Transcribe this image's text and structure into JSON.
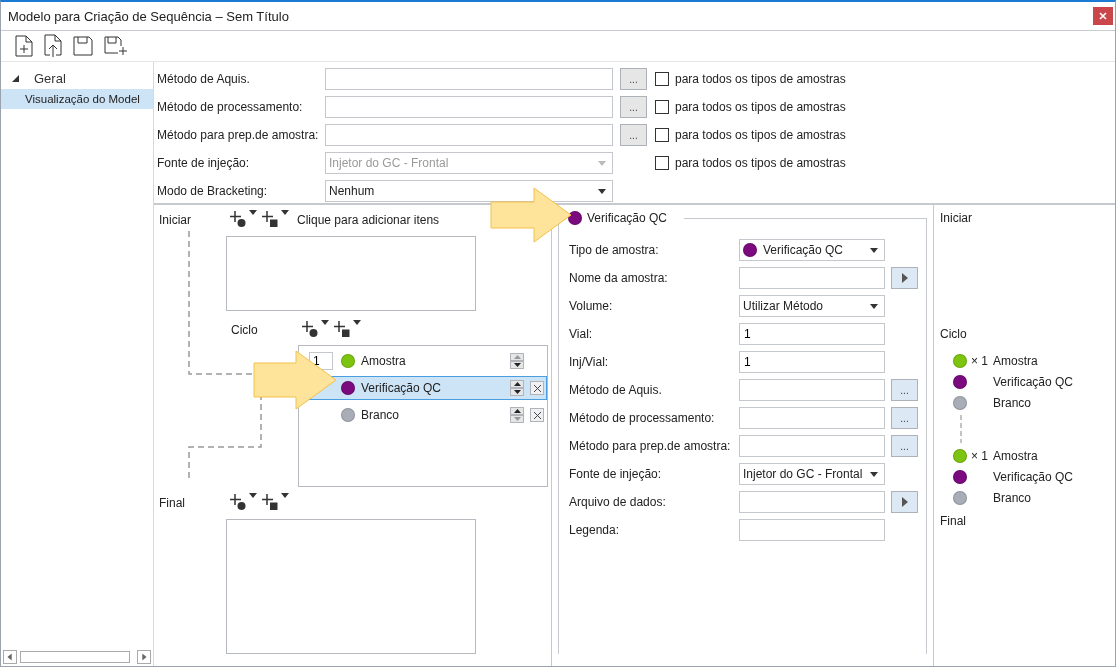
{
  "window": {
    "title": "Modelo para Criação de Sequência – Sem Título"
  },
  "sidebar": {
    "tree": [
      {
        "label": "Geral",
        "expanded": true,
        "selected": false,
        "children": [
          {
            "label": "Visualização do Model",
            "selected": true
          }
        ]
      }
    ]
  },
  "general_form": {
    "rows": [
      {
        "kind": "browse",
        "label": "Método de Aquis.",
        "button": "...",
        "checkbox": {
          "label": "para todos os tipos de amostras",
          "checked": false
        }
      },
      {
        "kind": "browse",
        "label": "Método de processamento:",
        "button": "...",
        "checkbox": {
          "label": "para todos os tipos de amostras",
          "checked": false
        }
      },
      {
        "kind": "browse",
        "label": "Método para prep.de amostra:",
        "button": "...",
        "checkbox": {
          "label": "para todos os tipos de amostras",
          "checked": false
        }
      },
      {
        "kind": "dropdown",
        "label": "Fonte de injeção:",
        "value": "Injetor do GC - Frontal",
        "disabled": true,
        "checkbox": {
          "label": "para todos os tipos de amostras",
          "checked": false
        }
      },
      {
        "kind": "dropdown",
        "label": "Modo de Bracketing:",
        "value": "Nenhum",
        "disabled": false
      }
    ]
  },
  "sequence_editor": {
    "start": {
      "label": "Iniciar",
      "hint": "Clique para adicionar itens"
    },
    "cycle": {
      "label": "Ciclo",
      "repeat": "1",
      "items": [
        {
          "name": "Amostra",
          "color": "#7cc40f",
          "selected": false,
          "removable": false
        },
        {
          "name": "Verificação QC",
          "color": "#7b0a7e",
          "selected": true,
          "removable": true
        },
        {
          "name": "Branco",
          "color": "#a9adb8",
          "selected": false,
          "removable": true
        }
      ]
    },
    "end": {
      "label": "Final"
    }
  },
  "properties": {
    "title": "Verificação QC",
    "color": "#7b0a7e",
    "rows": [
      {
        "kind": "select",
        "label": "Tipo de amostra:",
        "value": "Verificação QC",
        "color": "#7b0a7e"
      },
      {
        "kind": "arrow",
        "label": "Nome da amostra:"
      },
      {
        "kind": "select",
        "label": "Volume:",
        "value": "Utilizar Método"
      },
      {
        "kind": "text",
        "label": "Vial:",
        "value": "1"
      },
      {
        "kind": "text",
        "label": "Inj/Vial:",
        "value": "1"
      },
      {
        "kind": "browse",
        "label": "Método de Aquis.",
        "button": "..."
      },
      {
        "kind": "browse",
        "label": "Método de processamento:",
        "button": "..."
      },
      {
        "kind": "browse",
        "label": "Método para prep.de amostra:",
        "button": "..."
      },
      {
        "kind": "select",
        "label": "Fonte de injeção:",
        "value": "Injetor do GC - Frontal"
      },
      {
        "kind": "arrow",
        "label": "Arquivo de dados:"
      },
      {
        "kind": "text",
        "label": "Legenda:"
      }
    ]
  },
  "preview": {
    "start_label": "Iniciar",
    "cycle_label": "Ciclo",
    "groups": [
      [
        {
          "count": "× 1",
          "name": "Amostra",
          "color": "#7cc40f"
        },
        {
          "name": "Verificação QC",
          "color": "#7b0a7e"
        },
        {
          "name": "Branco",
          "color": "#a9adb8"
        }
      ],
      [
        {
          "count": "× 1",
          "name": "Amostra",
          "color": "#7cc40f"
        },
        {
          "name": "Verificação QC",
          "color": "#7b0a7e"
        },
        {
          "name": "Branco",
          "color": "#a9adb8"
        }
      ]
    ],
    "end_label": "Final"
  }
}
